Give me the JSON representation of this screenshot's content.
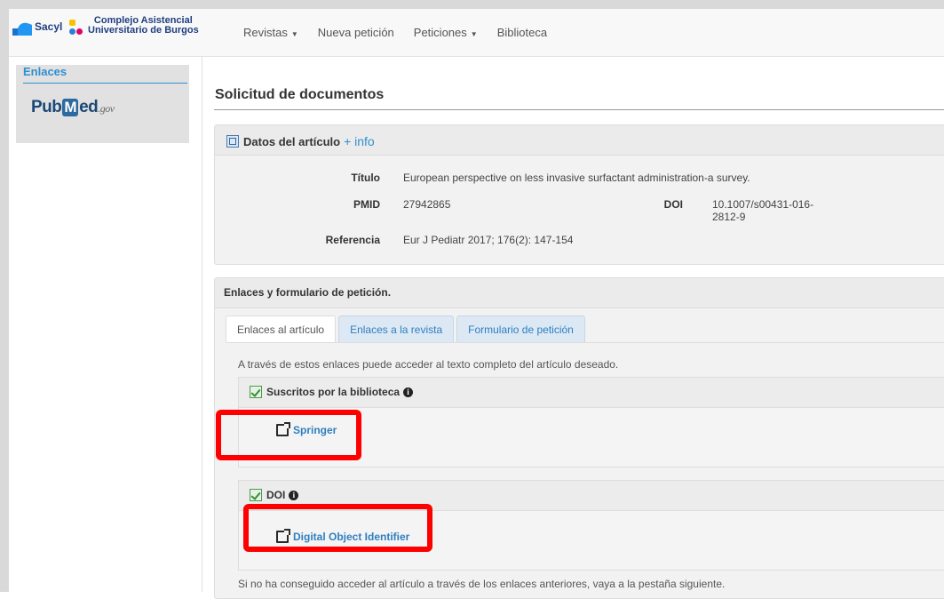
{
  "brand": {
    "sacyl": "Sacyl",
    "hospital_line1": "Complejo Asistencial",
    "hospital_line2": "Universitario de Burgos"
  },
  "nav": {
    "items": [
      {
        "label": "Revistas",
        "dropdown": true
      },
      {
        "label": "Nueva petición",
        "dropdown": false
      },
      {
        "label": "Peticiones",
        "dropdown": true
      },
      {
        "label": "Biblioteca",
        "dropdown": false
      }
    ]
  },
  "sidebar": {
    "title": "Enlaces",
    "pubmed_pub": "Pub",
    "pubmed_m": "M",
    "pubmed_ed": "ed",
    "pubmed_gov": ".gov"
  },
  "main": {
    "title": "Solicitud de documentos",
    "article_panel": {
      "heading": "Datos del artículo",
      "info_link": "+ info",
      "titulo_label": "Título",
      "titulo_value": "European perspective on less invasive surfactant administration-a survey.",
      "pmid_label": "PMID",
      "pmid_value": "27942865",
      "doi_label": "DOI",
      "doi_value_line1": "10.1007/s00431-016-",
      "doi_value_line2": "2812-9",
      "referencia_label": "Referencia",
      "referencia_value": "Eur J Pediatr 2017; 176(2): 147-154"
    },
    "links_panel": {
      "heading": "Enlaces y formulario de petición.",
      "tabs": [
        {
          "label": "Enlaces al artículo",
          "active": true
        },
        {
          "label": "Enlaces a la revista",
          "active": false
        },
        {
          "label": "Formulario de petición",
          "active": false
        }
      ],
      "intro": "A través de estos enlaces puede acceder al texto completo del artículo deseado.",
      "sections": [
        {
          "title": "Suscritos por la biblioteca",
          "link": "Springer"
        },
        {
          "title": "DOI",
          "link": "Digital Object Identifier"
        }
      ],
      "footer": "Si no ha conseguido acceder al artículo a través de los enlaces anteriores, vaya a la pestaña siguiente."
    }
  },
  "colors": {
    "highlight": "#ff0000",
    "link": "#2f7fc0",
    "accent": "#2f8fd0"
  }
}
